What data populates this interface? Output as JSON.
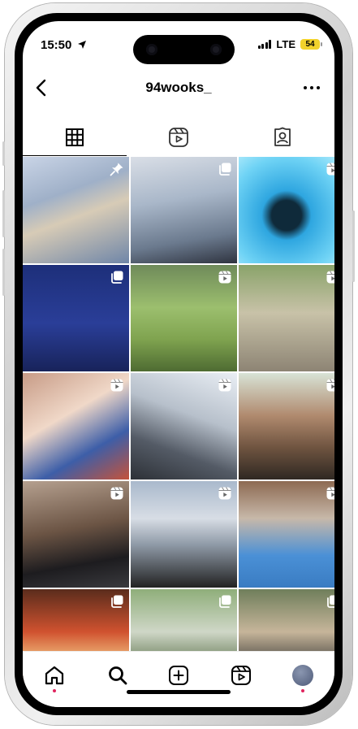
{
  "status_bar": {
    "time": "15:50",
    "network": "LTE",
    "battery": "54"
  },
  "header": {
    "username": "94wooks_"
  },
  "icons": {
    "back": "chevron-left-icon",
    "more": "more-horizontal-icon",
    "grid_tab": "grid-icon",
    "reels_tab": "reels-icon",
    "tagged_tab": "tagged-person-icon",
    "pin": "pin-icon",
    "reel_badge": "reel-icon",
    "multi_badge": "carousel-icon"
  },
  "posts": [
    {
      "badge": "pin"
    },
    {
      "badge": "carousel"
    },
    {
      "badge": "reel"
    },
    {
      "badge": "carousel"
    },
    {
      "badge": "reel"
    },
    {
      "badge": "reel"
    },
    {
      "badge": "reel"
    },
    {
      "badge": "reel"
    },
    {
      "badge": "reel"
    },
    {
      "badge": "reel"
    },
    {
      "badge": "reel"
    },
    {
      "badge": "reel"
    },
    {
      "badge": "carousel"
    },
    {
      "badge": "carousel"
    },
    {
      "badge": "carousel"
    }
  ],
  "bottom_nav": [
    {
      "name": "home",
      "icon": "home-icon",
      "active_dot": true
    },
    {
      "name": "search",
      "icon": "search-icon",
      "active_dot": false
    },
    {
      "name": "create",
      "icon": "plus-square-icon",
      "active_dot": false
    },
    {
      "name": "reels",
      "icon": "reels-icon",
      "active_dot": false
    },
    {
      "name": "profile",
      "icon": "avatar",
      "active_dot": true
    }
  ],
  "colors": {
    "notification_dot": "#e0245e",
    "battery": "#f2d22c"
  }
}
